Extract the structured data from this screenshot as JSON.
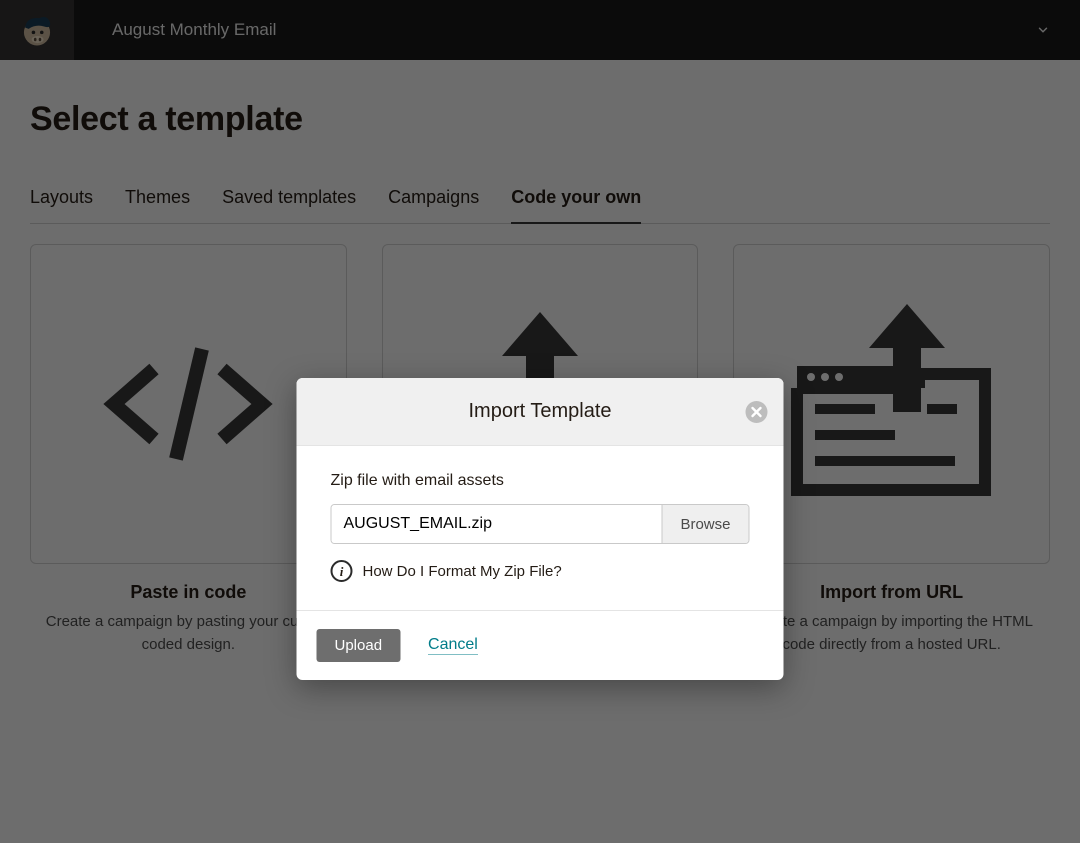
{
  "header": {
    "campaign": "August Monthly Email"
  },
  "page_title": "Select a template",
  "tabs": {
    "layouts": "Layouts",
    "themes": "Themes",
    "saved": "Saved templates",
    "campaigns": "Campaigns",
    "code": "Code your own"
  },
  "cards": {
    "paste": {
      "title": "Paste in code",
      "desc": "Create a campaign by pasting your custom coded design."
    },
    "url": {
      "title": "Import from URL",
      "desc": "Create a campaign by importing the HTML code directly from a hosted URL."
    }
  },
  "modal": {
    "title": "Import Template",
    "label": "Zip file with email assets",
    "filename": "AUGUST_EMAIL.zip",
    "browse": "Browse",
    "help": "How Do I Format My Zip File?",
    "upload": "Upload",
    "cancel": "Cancel"
  }
}
